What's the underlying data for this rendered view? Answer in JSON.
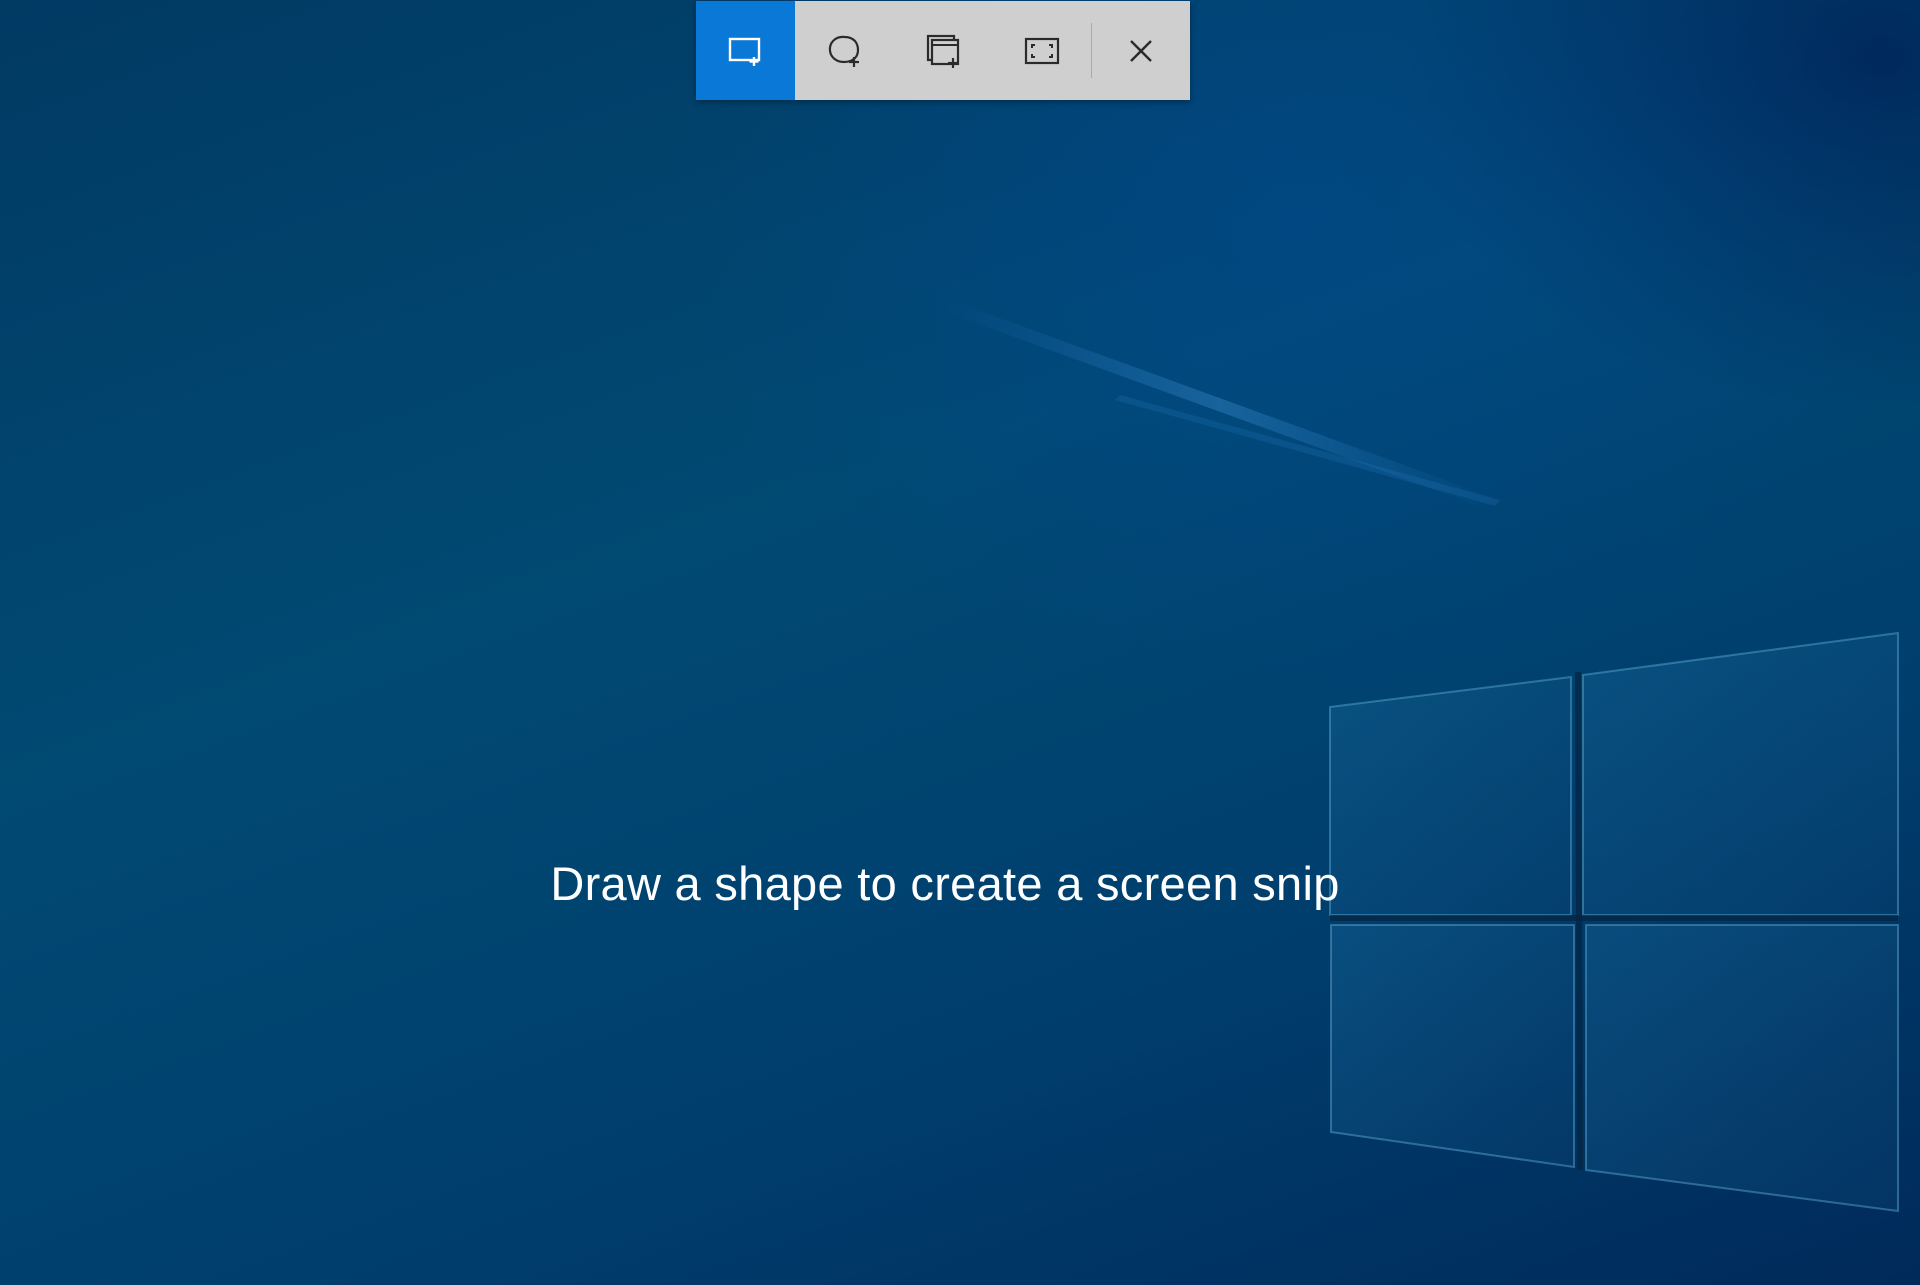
{
  "colors": {
    "accent": "#0a78d7",
    "toolbar_bg": "#cfcfcf",
    "icon_dark": "#2b2b2b",
    "icon_light": "#ffffff",
    "hint_text": "#ffffff"
  },
  "toolbar": {
    "buttons": [
      {
        "icon": "rectangular-snip-icon",
        "active": true
      },
      {
        "icon": "freeform-snip-icon",
        "active": false
      },
      {
        "icon": "window-snip-icon",
        "active": false
      },
      {
        "icon": "fullscreen-snip-icon",
        "active": false
      },
      {
        "icon": "close-icon",
        "active": false
      }
    ]
  },
  "hint": {
    "text": "Draw a shape to create a screen snip"
  }
}
